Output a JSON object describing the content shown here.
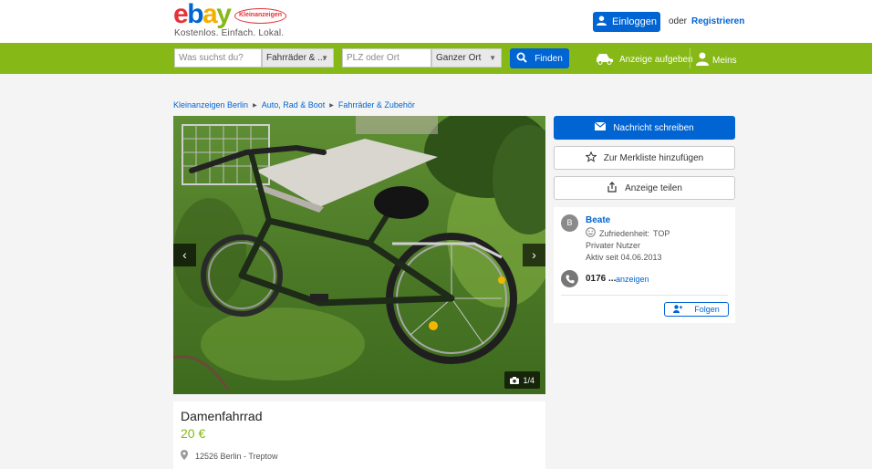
{
  "header": {
    "logo_badge": "Kleinanzeigen",
    "tagline": "Kostenlos. Einfach. Lokal.",
    "login_label": "Einloggen",
    "or_label": "oder",
    "register_label": "Registrieren"
  },
  "search": {
    "query_placeholder": "Was suchst du?",
    "category_value": "Fahrräder & ...",
    "location_placeholder": "PLZ oder Ort",
    "radius_value": "Ganzer Ort",
    "find_label": "Finden",
    "post_ad_label": "Anzeige aufgeben",
    "mine_label": "Meins"
  },
  "breadcrumb": {
    "items": [
      "Kleinanzeigen Berlin",
      "Auto, Rad & Boot",
      "Fahrräder & Zubehör"
    ]
  },
  "gallery": {
    "counter": "1/4",
    "prev_label": "‹",
    "next_label": "›"
  },
  "ad": {
    "title": "Damenfahrrad",
    "price": "20 €",
    "location": "12526 Berlin - Treptow"
  },
  "actions": {
    "message_label": "Nachricht schreiben",
    "watchlist_label": "Zur Merkliste hinzufügen",
    "share_label": "Anzeige teilen"
  },
  "seller": {
    "avatar_letter": "B",
    "name": "Beate",
    "satisfaction_label": "Zufriedenheit:",
    "satisfaction_value": "TOP",
    "type": "Privater Nutzer",
    "active_since": "Aktiv seit 04.06.2013",
    "phone": "0176 ...",
    "show_phone_label": "anzeigen",
    "follow_label": "Folgen"
  },
  "colors": {
    "brand_blue": "#0064d2",
    "brand_green": "#86b817",
    "background": "#f4f4f4"
  }
}
